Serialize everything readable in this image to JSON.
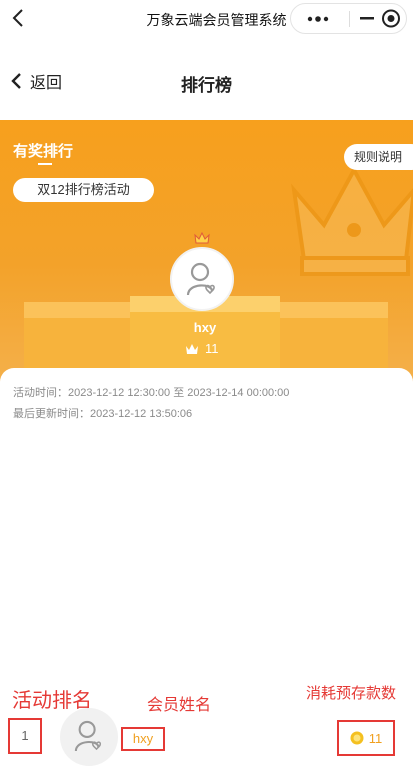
{
  "topbar": {
    "app_title": "万象云端会员管理系统",
    "back_icon": "chevron-left-icon",
    "more_icon": "more-dots-icon",
    "minimize_icon": "minus-icon",
    "close_icon": "target-circle-icon"
  },
  "navbar": {
    "back_label": "返回",
    "title": "排行榜"
  },
  "banner": {
    "section_title": "有奖排行",
    "activity_name": "双12排行榜活动",
    "rules_label": "规则说明",
    "top_member": {
      "name": "hxy",
      "score": "11"
    },
    "colors": {
      "banner_orange": "#f7a01d",
      "podium_orange": "#f8bc42"
    }
  },
  "activity": {
    "time_line": "活动时间：2023-12-12 12:30:00 至 2023-12-14 00:00:00",
    "updated_line": "最后更新时间：2023-12-12 13:50:06"
  },
  "ranking": [
    {
      "rank": "1",
      "name": "hxy",
      "score": "11"
    }
  ],
  "annotations": {
    "rank_label": "活动排名",
    "name_label": "会员姓名",
    "score_label": "消耗预存款数",
    "color": "#e53935"
  }
}
